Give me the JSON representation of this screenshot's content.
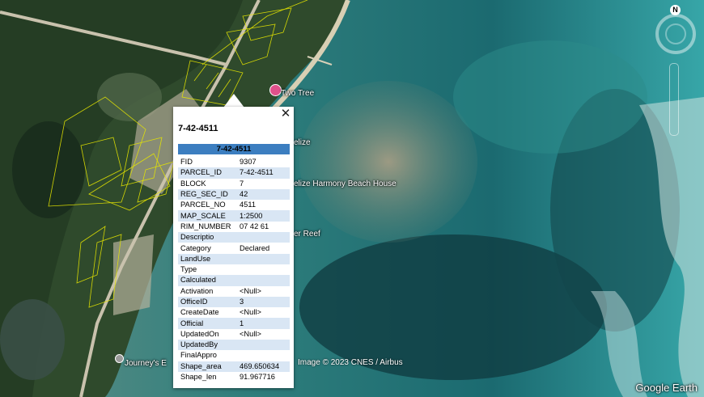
{
  "map": {
    "place_labels": [
      {
        "text": "Two Tree",
        "icon": "pink-pin-icon"
      },
      {
        "text": "elize"
      },
      {
        "text": "elize Harmony Beach House"
      },
      {
        "text": "er Reef"
      },
      {
        "text": "Journey's E",
        "icon": "gray-pin-icon"
      }
    ],
    "attribution": "Image © 2023 CNES / Airbus",
    "brand": "Google Earth",
    "north": "N"
  },
  "popup": {
    "title": "7-42-4511",
    "header": "7-42-4511",
    "close_icon": "close-icon",
    "attributes": [
      {
        "key": "FID",
        "value": "9307"
      },
      {
        "key": "PARCEL_ID",
        "value": "7-42-4511"
      },
      {
        "key": "BLOCK",
        "value": "7"
      },
      {
        "key": "REG_SEC_ID",
        "value": "42"
      },
      {
        "key": "PARCEL_NO",
        "value": "4511"
      },
      {
        "key": "MAP_SCALE",
        "value": "1:2500"
      },
      {
        "key": "RIM_NUMBER",
        "value": "07 42 61"
      },
      {
        "key": "Descriptio",
        "value": ""
      },
      {
        "key": "Category",
        "value": "Declared"
      },
      {
        "key": "LandUse",
        "value": ""
      },
      {
        "key": "Type",
        "value": ""
      },
      {
        "key": "Calculated",
        "value": ""
      },
      {
        "key": "Activation",
        "value": "<Null>"
      },
      {
        "key": "OfficeID",
        "value": "3"
      },
      {
        "key": "CreateDate",
        "value": "<Null>"
      },
      {
        "key": "Official",
        "value": "1"
      },
      {
        "key": "UpdatedOn",
        "value": "<Null>"
      },
      {
        "key": "UpdatedBy",
        "value": ""
      },
      {
        "key": "FinalAppro",
        "value": ""
      },
      {
        "key": "Shape_area",
        "value": "469.650634"
      },
      {
        "key": "Shape_len",
        "value": "91.967716"
      }
    ]
  },
  "colors": {
    "header_blue": "#3c7ec0",
    "row_shade": "#d9e6f4",
    "parcel_outline": "#e6e600",
    "pin_pink": "#e0518b"
  }
}
